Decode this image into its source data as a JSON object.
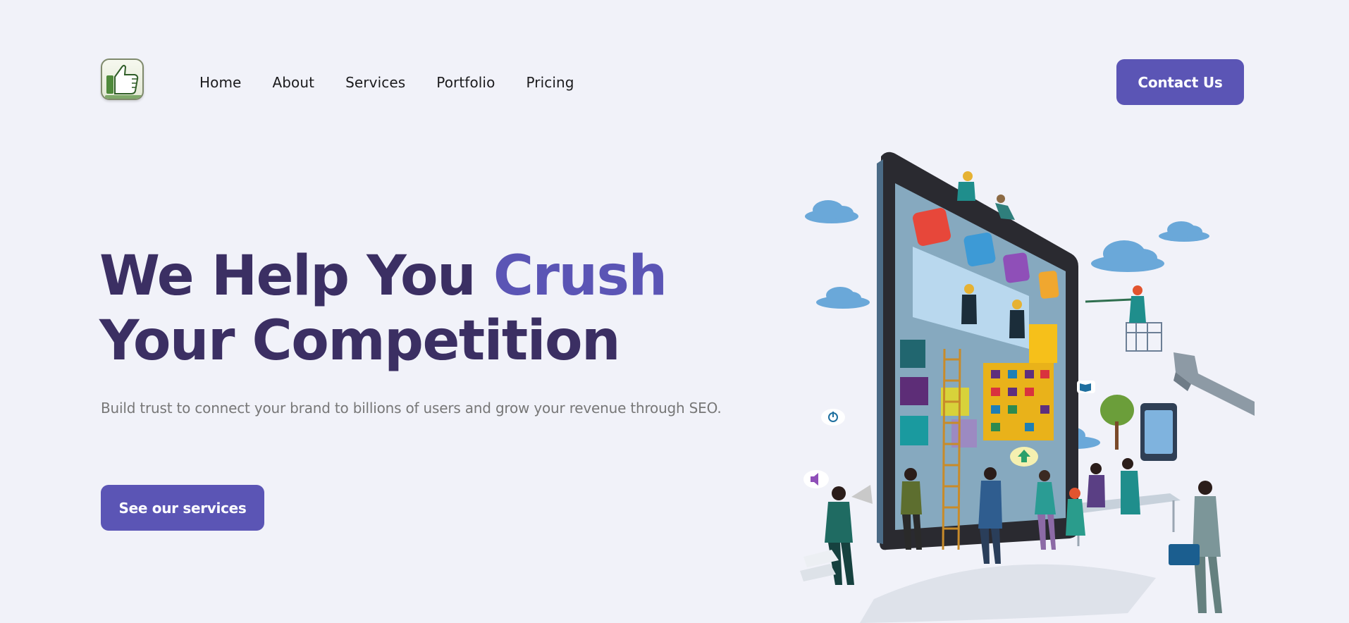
{
  "header": {
    "logo_icon": "thumbs-up-icon",
    "nav": [
      {
        "label": "Home"
      },
      {
        "label": "About"
      },
      {
        "label": "Services"
      },
      {
        "label": "Portfolio"
      },
      {
        "label": "Pricing"
      }
    ],
    "contact_label": "Contact Us"
  },
  "hero": {
    "title_part1": "We Help You ",
    "title_accent": "Crush",
    "title_part2": " Your Competition",
    "subtitle": "Build trust to connect your brand to billions of users and grow your revenue through SEO.",
    "cta_label": "See our services"
  },
  "colors": {
    "background": "#f1f2f9",
    "accent": "#5b55b5",
    "heading": "#3b2f63",
    "subtitle": "#777777"
  },
  "illustration": {
    "subject": "tablet-teamwork-illustration",
    "icons": [
      "mail-icon",
      "bird-icon",
      "music-icon",
      "phone-icon",
      "power-icon",
      "speaker-icon",
      "book-icon",
      "upload-icon"
    ]
  }
}
